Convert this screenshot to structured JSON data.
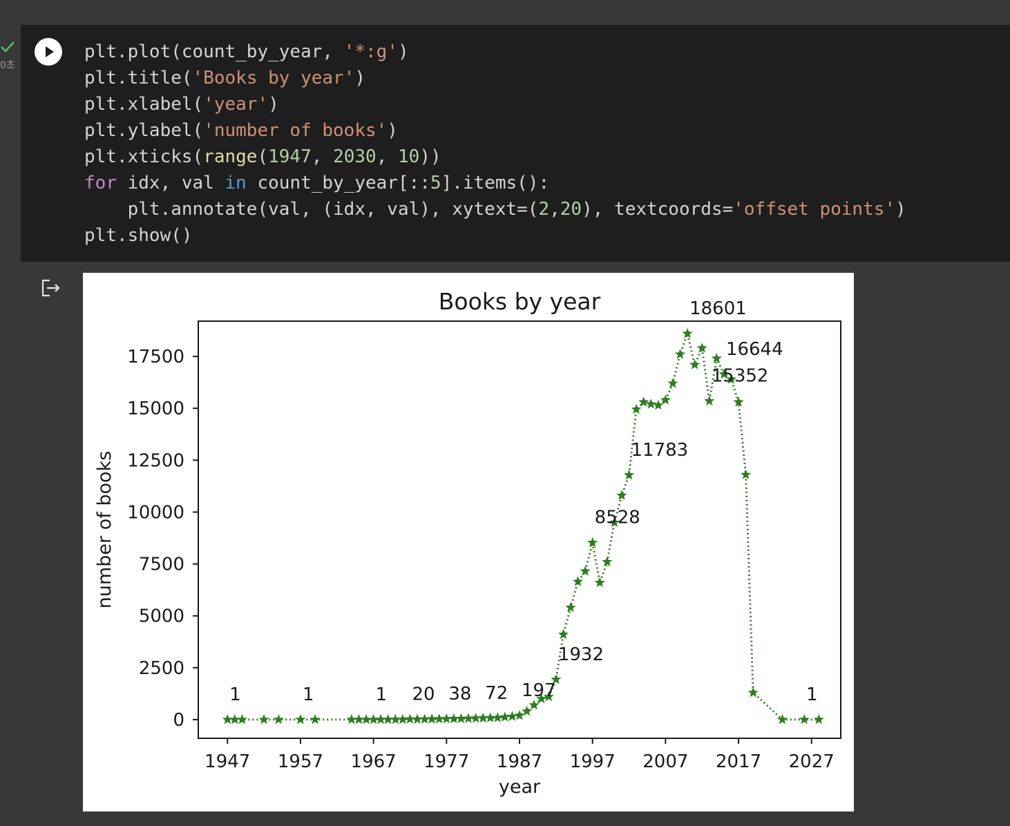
{
  "cell": {
    "status": "✓",
    "exec_time": "0초",
    "run_button": "run",
    "code_lines": [
      [
        {
          "t": "plt.plot(count_by_year, ",
          "c": ""
        },
        {
          "t": "'*:g'",
          "c": "str"
        },
        {
          "t": ")",
          "c": ""
        }
      ],
      [
        {
          "t": "plt.title(",
          "c": ""
        },
        {
          "t": "'Books by year'",
          "c": "str"
        },
        {
          "t": ")",
          "c": ""
        }
      ],
      [
        {
          "t": "plt.xlabel(",
          "c": ""
        },
        {
          "t": "'year'",
          "c": "str"
        },
        {
          "t": ")",
          "c": ""
        }
      ],
      [
        {
          "t": "plt.ylabel(",
          "c": ""
        },
        {
          "t": "'number of books'",
          "c": "str"
        },
        {
          "t": ")",
          "c": ""
        }
      ],
      [
        {
          "t": "plt.xticks(",
          "c": ""
        },
        {
          "t": "range",
          "c": "fn"
        },
        {
          "t": "(",
          "c": ""
        },
        {
          "t": "1947",
          "c": "num"
        },
        {
          "t": ", ",
          "c": ""
        },
        {
          "t": "2030",
          "c": "num"
        },
        {
          "t": ", ",
          "c": ""
        },
        {
          "t": "10",
          "c": "num"
        },
        {
          "t": "))",
          "c": ""
        }
      ],
      [
        {
          "t": "for",
          "c": "kw"
        },
        {
          "t": " idx, val ",
          "c": ""
        },
        {
          "t": "in",
          "c": "kw2"
        },
        {
          "t": " count_by_year[::",
          "c": ""
        },
        {
          "t": "5",
          "c": "num"
        },
        {
          "t": "].items():",
          "c": ""
        }
      ],
      [
        {
          "t": "    plt.annotate(val, (idx, val), xytext=(",
          "c": ""
        },
        {
          "t": "2",
          "c": "num"
        },
        {
          "t": ",",
          "c": ""
        },
        {
          "t": "20",
          "c": "num"
        },
        {
          "t": "), textcoords=",
          "c": ""
        },
        {
          "t": "'offset points'",
          "c": "str"
        },
        {
          "t": ")",
          "c": ""
        }
      ],
      [
        {
          "t": "plt.show()",
          "c": ""
        }
      ]
    ]
  },
  "output": {
    "icon": "output-redirect-icon"
  },
  "chart_data": {
    "type": "line",
    "title": "Books by year",
    "xlabel": "year",
    "ylabel": "number of books",
    "xlim": [
      1943,
      2031
    ],
    "ylim": [
      -900,
      19200
    ],
    "xticks": [
      1947,
      1957,
      1967,
      1977,
      1987,
      1997,
      2007,
      2017,
      2027
    ],
    "yticks": [
      0,
      2500,
      5000,
      7500,
      10000,
      12500,
      15000,
      17500
    ],
    "line_color": "#2e7d1f",
    "marker": "star",
    "linestyle": "dotted",
    "series": [
      {
        "points": [
          [
            1947,
            1
          ],
          [
            1948,
            1
          ],
          [
            1949,
            1
          ],
          [
            1952,
            1
          ],
          [
            1954,
            1
          ],
          [
            1957,
            1
          ],
          [
            1959,
            1
          ],
          [
            1964,
            1
          ],
          [
            1965,
            1
          ],
          [
            1966,
            1
          ],
          [
            1967,
            1
          ],
          [
            1968,
            2
          ],
          [
            1969,
            3
          ],
          [
            1970,
            5
          ],
          [
            1971,
            8
          ],
          [
            1972,
            20
          ],
          [
            1973,
            15
          ],
          [
            1974,
            18
          ],
          [
            1975,
            22
          ],
          [
            1976,
            30
          ],
          [
            1977,
            38
          ],
          [
            1978,
            40
          ],
          [
            1979,
            45
          ],
          [
            1980,
            55
          ],
          [
            1981,
            65
          ],
          [
            1982,
            72
          ],
          [
            1983,
            80
          ],
          [
            1984,
            90
          ],
          [
            1985,
            120
          ],
          [
            1986,
            150
          ],
          [
            1987,
            197
          ],
          [
            1988,
            400
          ],
          [
            1989,
            700
          ],
          [
            1990,
            1000
          ],
          [
            1991,
            1100
          ],
          [
            1992,
            1932
          ],
          [
            1993,
            4100
          ],
          [
            1994,
            5400
          ],
          [
            1995,
            6650
          ],
          [
            1996,
            7150
          ],
          [
            1997,
            8528
          ],
          [
            1998,
            6600
          ],
          [
            1999,
            7600
          ],
          [
            2000,
            9500
          ],
          [
            2001,
            10800
          ],
          [
            2002,
            11783
          ],
          [
            2003,
            14950
          ],
          [
            2004,
            15300
          ],
          [
            2005,
            15200
          ],
          [
            2006,
            15150
          ],
          [
            2007,
            15400
          ],
          [
            2008,
            16200
          ],
          [
            2009,
            17600
          ],
          [
            2010,
            18601
          ],
          [
            2011,
            17100
          ],
          [
            2012,
            17900
          ],
          [
            2013,
            15352
          ],
          [
            2014,
            17400
          ],
          [
            2015,
            16644
          ],
          [
            2016,
            16400
          ],
          [
            2017,
            15300
          ],
          [
            2018,
            11800
          ],
          [
            2019,
            1300
          ],
          [
            2023,
            1
          ],
          [
            2026,
            1
          ],
          [
            2028,
            1
          ]
        ]
      }
    ],
    "annotations": [
      {
        "x": 1947,
        "y": 1,
        "label": "1"
      },
      {
        "x": 1957,
        "y": 1,
        "label": "1"
      },
      {
        "x": 1967,
        "y": 1,
        "label": "1"
      },
      {
        "x": 1972,
        "y": 20,
        "label": "20"
      },
      {
        "x": 1977,
        "y": 38,
        "label": "38"
      },
      {
        "x": 1982,
        "y": 72,
        "label": "72"
      },
      {
        "x": 1987,
        "y": 197,
        "label": "197"
      },
      {
        "x": 1992,
        "y": 1932,
        "label": "1932"
      },
      {
        "x": 1997,
        "y": 8528,
        "label": "8528"
      },
      {
        "x": 2002,
        "y": 11783,
        "label": "11783"
      },
      {
        "x": 2010,
        "y": 18601,
        "label": "18601"
      },
      {
        "x": 2013,
        "y": 15352,
        "label": "15352"
      },
      {
        "x": 2015,
        "y": 16644,
        "label": "16644"
      },
      {
        "x": 2026,
        "y": 1,
        "label": "1"
      }
    ]
  }
}
